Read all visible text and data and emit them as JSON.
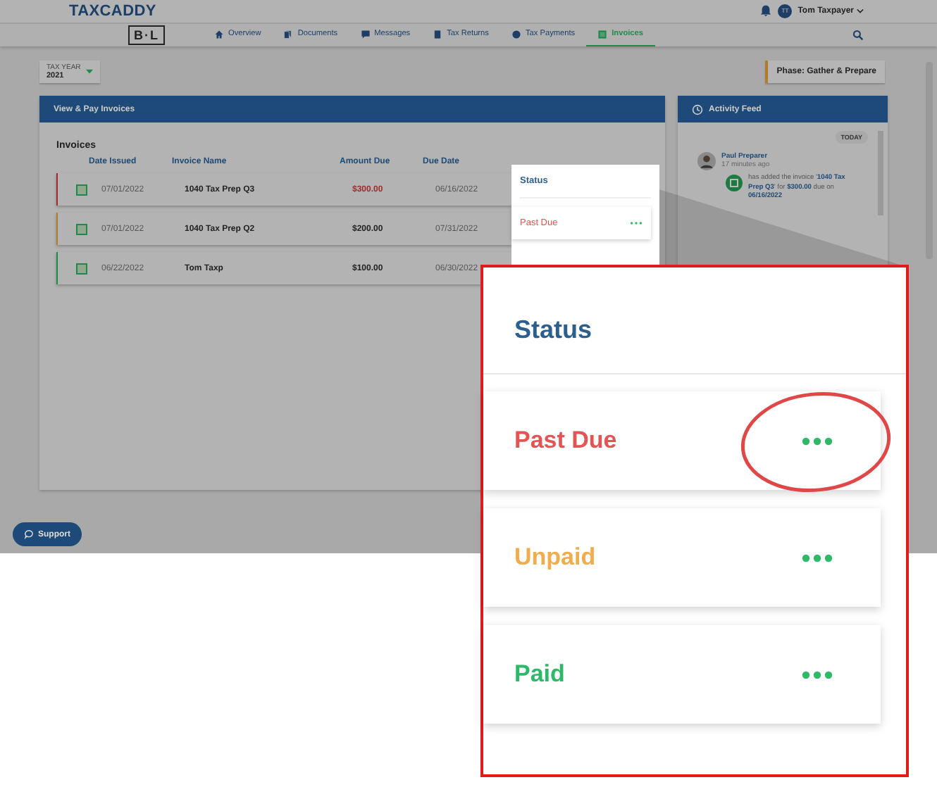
{
  "header": {
    "logo": "TAXCADDY",
    "user_initials": "TT",
    "user_name": "Tom Taxpayer"
  },
  "nav": {
    "firm_logo": "B·L",
    "items": [
      {
        "label": "Overview",
        "kind": "home",
        "selected": false
      },
      {
        "label": "Documents",
        "kind": "docs",
        "selected": false
      },
      {
        "label": "Messages",
        "kind": "chat",
        "selected": false
      },
      {
        "label": "Tax Returns",
        "kind": "return",
        "selected": false
      },
      {
        "label": "Tax Payments",
        "kind": "dollar",
        "selected": false
      },
      {
        "label": "Invoices",
        "kind": "invoice",
        "selected": true
      }
    ]
  },
  "tax_year": {
    "label": "TAX YEAR",
    "value": "2021"
  },
  "phase": "Phase: Gather & Prepare",
  "invoices_panel": {
    "title": "View & Pay Invoices",
    "heading": "Invoices",
    "columns": [
      "Date Issued",
      "Invoice Name",
      "Amount Due",
      "Due Date"
    ],
    "rows": [
      {
        "date_issued": "07/01/2022",
        "name": "1040 Tax Prep Q3",
        "amount": "$300.00",
        "due_date": "06/16/2022",
        "kind": "past_due"
      },
      {
        "date_issued": "07/01/2022",
        "name": "1040 Tax Prep Q2",
        "amount": "$200.00",
        "due_date": "07/31/2022",
        "kind": "unpaid"
      },
      {
        "date_issued": "06/22/2022",
        "name": "Tom Taxp",
        "amount": "$100.00",
        "due_date": "06/30/2022",
        "kind": "paid"
      }
    ]
  },
  "status_popup": {
    "heading": "Status",
    "items": [
      {
        "label": "Past Due",
        "kind": "past_due"
      }
    ]
  },
  "activity_feed": {
    "title": "Activity Feed",
    "day": "TODAY",
    "entries": [
      {
        "author": "Paul Preparer",
        "time": "17 minutes ago",
        "text": "has added the invoice '**1040 Tax Prep Q3**' for **$300.00** due on **06/16/2022**"
      }
    ]
  },
  "support_button": "Support",
  "callout": {
    "heading": "Status",
    "items": [
      {
        "label": "Past Due",
        "kind": "past_due",
        "circled": true
      },
      {
        "label": "Unpaid",
        "kind": "unpaid",
        "circled": false
      },
      {
        "label": "Paid",
        "kind": "paid",
        "circled": false
      }
    ]
  }
}
